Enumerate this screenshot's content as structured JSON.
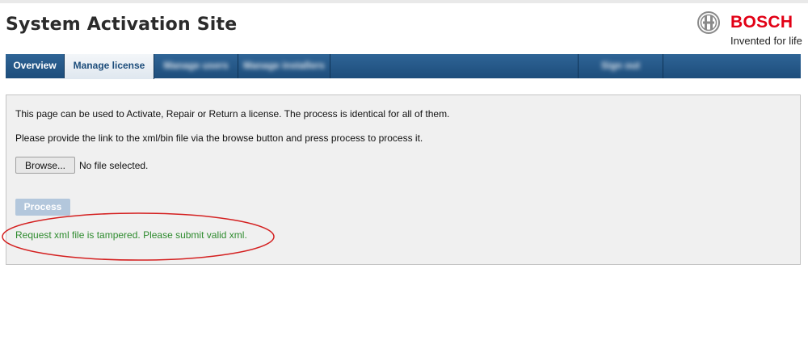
{
  "header": {
    "title": "System Activation Site",
    "brand": {
      "name": "BOSCH",
      "tagline": "Invented for life",
      "color": "#e20015"
    }
  },
  "nav": {
    "tabs": [
      {
        "label": "Overview",
        "active": false,
        "obscured": false
      },
      {
        "label": "Manage license",
        "active": true,
        "obscured": false
      },
      {
        "label": "Manage users",
        "active": false,
        "obscured": true
      },
      {
        "label": "Manage installers",
        "active": false,
        "obscured": true
      },
      {
        "label": "Sign out",
        "active": false,
        "obscured": true
      }
    ],
    "color": "#1d4d7b"
  },
  "main": {
    "intro": "This page can be used to Activate, Repair or Return a license. The process is identical for all of them.",
    "instructions": "Please provide the link to the xml/bin file via the browse button and press process to process it.",
    "browse_label": "Browse...",
    "file_status": "No file selected.",
    "process_label": "Process",
    "error_message": "Request xml file is tampered. Please submit valid xml.",
    "error_color": "#2e8b2e"
  }
}
